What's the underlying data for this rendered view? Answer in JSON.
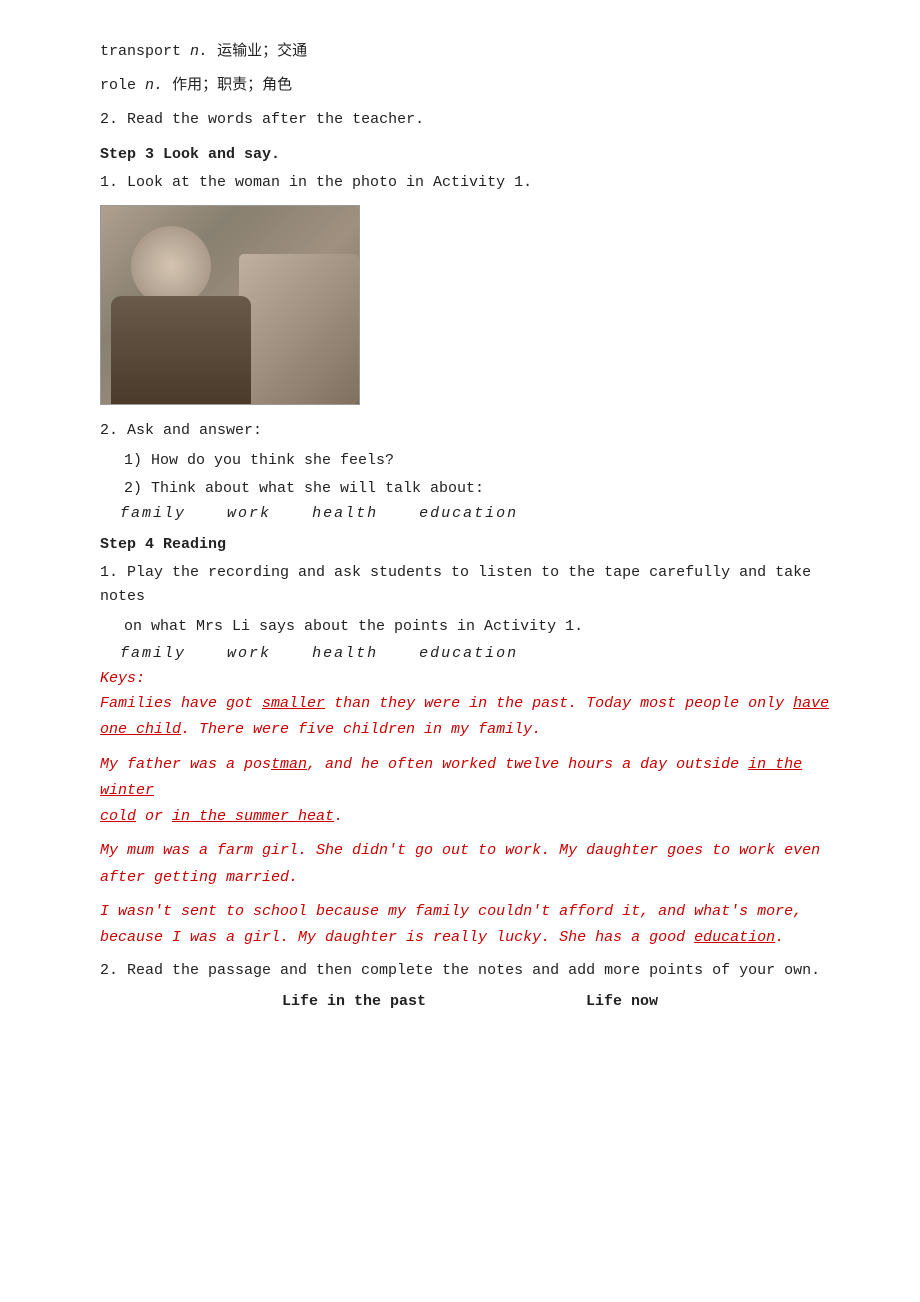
{
  "vocab": [
    {
      "word": "transport",
      "pos": "n.",
      "meaning": "运输业；交通"
    },
    {
      "word": "role",
      "pos": "n.",
      "meaning": "作用；职责；角色"
    }
  ],
  "step2": {
    "label": "2.",
    "text": "Read the words after the teacher."
  },
  "step3": {
    "heading": "Step 3 Look and say.",
    "item1": "1. Look at the woman in the photo in Activity 1.",
    "item2_label": "2. Ask and answer:",
    "item2_q1": "1) How do you think she feels?",
    "item2_q2": "2) Think about what she will talk about:",
    "topics": [
      "family",
      "work",
      "health",
      "education"
    ]
  },
  "step4": {
    "heading": "Step 4 Reading",
    "item1_line1": "1. Play the recording and ask students to listen to the tape carefully and take notes",
    "item1_line2": "on what Mrs Li says about the points in Activity 1.",
    "topics": [
      "family",
      "work",
      "health",
      "education"
    ],
    "keys_label": "Keys:",
    "passage": [
      {
        "id": "p1",
        "parts": [
          {
            "text": "Families hav",
            "style": "normal"
          },
          {
            "text": "e got ",
            "style": "normal"
          },
          {
            "text": "smaller",
            "style": "underline"
          },
          {
            "text": " than they were in the past. Today most people only ",
            "style": "normal"
          },
          {
            "text": "have",
            "style": "underline"
          },
          {
            "text": " ",
            "style": "normal"
          }
        ],
        "line2_parts": [
          {
            "text": "one child",
            "style": "underline"
          },
          {
            "text": ". There were five children in my family.",
            "style": "normal"
          }
        ]
      },
      {
        "id": "p2",
        "line1": "My father was a pos",
        "underline1": "tman",
        "mid": ", and he often worked twelve hours a day outside ",
        "underline2": "in the winter",
        "line2_start": "cold",
        "line2_or": " or ",
        "underline3": "in the summer heat",
        "line2_end": "."
      },
      {
        "id": "p3",
        "text": "My mum was a farm girl. She didn't go out to work. My daughter goes to work even after getting married."
      },
      {
        "id": "p4",
        "text1": "I wasn't sent to school because my family couldn't afford it, and what's more, because I was a girl. My daughter is really lucky. She has a good ",
        "underline": "education",
        "text2": "."
      }
    ],
    "item2": "2. Read the passage and then complete the notes and add more points of your own.",
    "table": {
      "col1": "Life in the past",
      "col2": "Life now"
    }
  }
}
